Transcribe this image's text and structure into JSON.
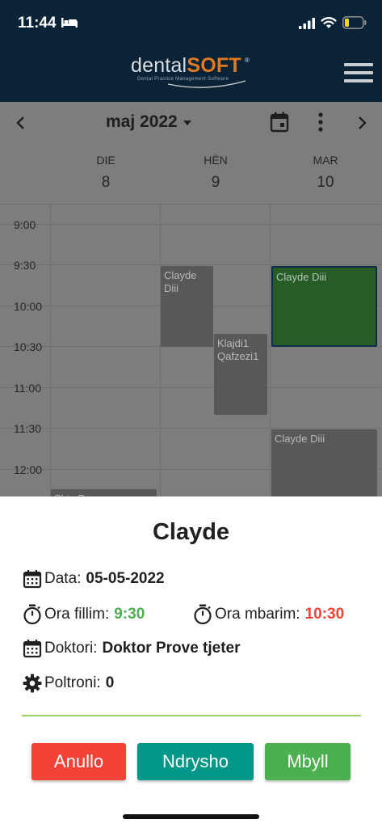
{
  "status_bar": {
    "time": "11:44"
  },
  "header": {
    "logo_dental": "dental",
    "logo_soft": "SOFT",
    "logo_reg": "®",
    "logo_tagline": "Dental Practice Management Software"
  },
  "calendar": {
    "month_title": "maj 2022",
    "days": [
      {
        "dow": "DIE",
        "num": "8"
      },
      {
        "dow": "HËN",
        "num": "9"
      },
      {
        "dow": "MAR",
        "num": "10"
      }
    ],
    "times": [
      "9:00",
      "9:30",
      "10:00",
      "10:30",
      "11:00",
      "11:30",
      "12:00"
    ],
    "events": [
      {
        "title": "Clayde Diii",
        "day": "HËN",
        "start": "9:30",
        "end": "10:30"
      },
      {
        "title": "Clayde Diii",
        "day": "MAR",
        "start": "9:30",
        "end": "10:30",
        "selected": true
      },
      {
        "title": "Klajdi1 Qafzezi1",
        "day": "HËN",
        "start": "10:20",
        "end": "11:20"
      },
      {
        "title": "Clayde Diii",
        "day": "MAR",
        "start": "11:30",
        "end": "12:30"
      },
      {
        "title": "Skte Prove",
        "day": "DIE",
        "start": "12:15",
        "end": "13:15"
      }
    ]
  },
  "appointment": {
    "name": "Clayde",
    "date_label": "Data:",
    "date_value": "05-05-2022",
    "start_label": "Ora fillim:",
    "start_value": "9:30",
    "end_label": "Ora mbarim:",
    "end_value": "10:30",
    "doctor_label": "Doktori:",
    "doctor_value": "Doktor Prove tjeter",
    "chair_label": "Poltroni:",
    "chair_value": "0"
  },
  "buttons": {
    "cancel": "Anullo",
    "edit": "Ndrysho",
    "close": "Mbyll"
  },
  "colors": {
    "header_bg": "#0b2337",
    "start_time": "#4caf50",
    "end_time": "#f44336",
    "cancel": "#f44336",
    "edit": "#009688",
    "close": "#4caf50"
  }
}
